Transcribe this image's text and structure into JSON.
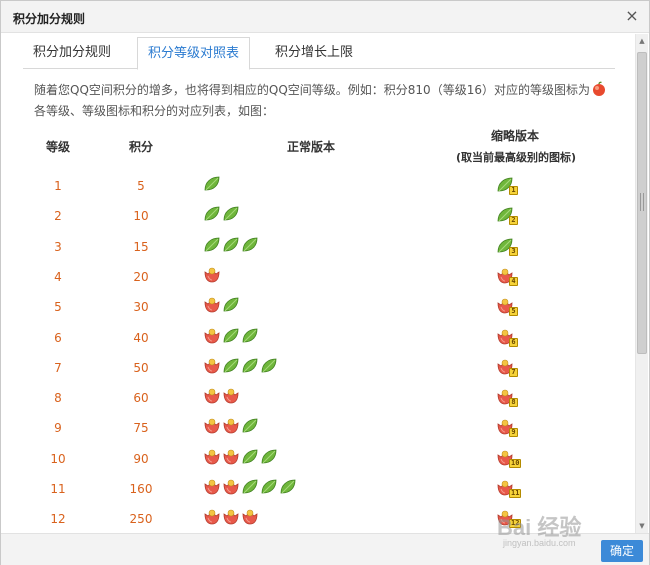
{
  "dialog": {
    "title": "积分加分规则",
    "close_symbol": "×"
  },
  "tabs": [
    {
      "label": "积分加分规则",
      "active": false
    },
    {
      "label": "积分等级对照表",
      "active": true
    },
    {
      "label": "积分增长上限",
      "active": false
    }
  ],
  "description": "随着您QQ空间积分的增多，也将得到相应的QQ空间等级。例如：积分810（等级16）对应的等级图标为",
  "description_line2": "各等级、等级图标和积分的对应列表，如图：",
  "headers": {
    "level": "等级",
    "points": "积分",
    "normal": "正常版本",
    "short": "缩略版本",
    "short_sub": "(取当前最高级别的图标)"
  },
  "rows": [
    {
      "level": "1",
      "points": "5",
      "icons": [
        "leaf"
      ],
      "short_icon": "leaf",
      "short_num": "1"
    },
    {
      "level": "2",
      "points": "10",
      "icons": [
        "leaf",
        "leaf"
      ],
      "short_icon": "leaf",
      "short_num": "2"
    },
    {
      "level": "3",
      "points": "15",
      "icons": [
        "leaf",
        "leaf",
        "leaf"
      ],
      "short_icon": "leaf",
      "short_num": "3"
    },
    {
      "level": "4",
      "points": "20",
      "icons": [
        "flower"
      ],
      "short_icon": "flower",
      "short_num": "4"
    },
    {
      "level": "5",
      "points": "30",
      "icons": [
        "flower",
        "leaf"
      ],
      "short_icon": "flower",
      "short_num": "5"
    },
    {
      "level": "6",
      "points": "40",
      "icons": [
        "flower",
        "leaf",
        "leaf"
      ],
      "short_icon": "flower",
      "short_num": "6"
    },
    {
      "level": "7",
      "points": "50",
      "icons": [
        "flower",
        "leaf",
        "leaf",
        "leaf"
      ],
      "short_icon": "flower",
      "short_num": "7"
    },
    {
      "level": "8",
      "points": "60",
      "icons": [
        "flower",
        "flower"
      ],
      "short_icon": "flower",
      "short_num": "8"
    },
    {
      "level": "9",
      "points": "75",
      "icons": [
        "flower",
        "flower",
        "leaf"
      ],
      "short_icon": "flower",
      "short_num": "9"
    },
    {
      "level": "10",
      "points": "90",
      "icons": [
        "flower",
        "flower",
        "leaf",
        "leaf"
      ],
      "short_icon": "flower",
      "short_num": "10"
    },
    {
      "level": "11",
      "points": "160",
      "icons": [
        "flower",
        "flower",
        "leaf",
        "leaf",
        "leaf"
      ],
      "short_icon": "flower",
      "short_num": "11"
    },
    {
      "level": "12",
      "points": "250",
      "icons": [
        "flower",
        "flower",
        "flower"
      ],
      "short_icon": "flower",
      "short_num": "12"
    }
  ],
  "footer": {
    "ok_label": "确定"
  },
  "watermark": {
    "big": "Bai 经验",
    "small": "jingyan.baidu.com"
  },
  "colors": {
    "accent": "#2b7bd0",
    "level_text": "#d9621d",
    "ok_button": "#3c8ad8",
    "leaf": "#6fb63b",
    "flower": "#e8594a"
  }
}
